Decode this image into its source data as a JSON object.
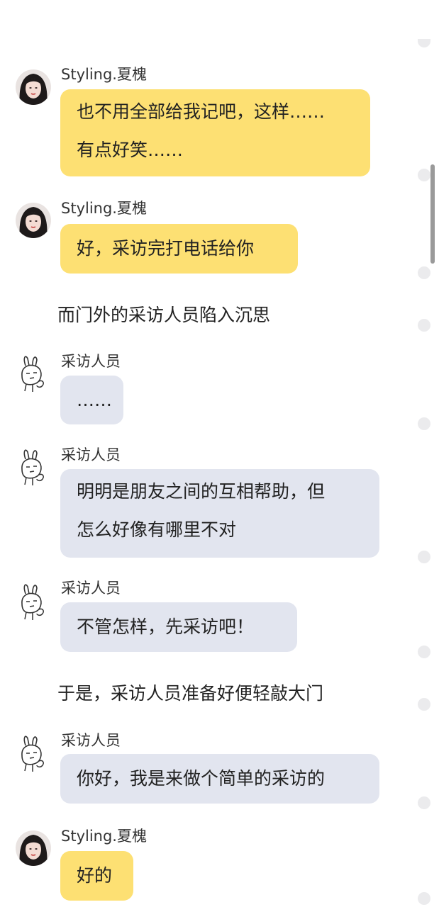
{
  "messages": [
    {
      "name": "Styling.夏槐",
      "lines": [
        "也不用全部给我记吧，这样……",
        "有点好笑……"
      ]
    },
    {
      "name": "Styling.夏槐",
      "lines": [
        "好，采访完打电话给你"
      ]
    },
    {
      "narration": "而门外的采访人员陷入沉思"
    },
    {
      "name": "采访人员",
      "lines": [
        "……"
      ]
    },
    {
      "name": "采访人员",
      "lines": [
        "明明是朋友之间的互相帮助，但",
        "怎么好像有哪里不对"
      ]
    },
    {
      "name": "采访人员",
      "lines": [
        "不管怎样，先采访吧！"
      ]
    },
    {
      "narration": "于是，采访人员准备好便轻敲大门"
    },
    {
      "name": "采访人员",
      "lines": [
        "你好，我是来做个简单的采访的"
      ]
    },
    {
      "name": "Styling.夏槐",
      "lines": [
        "好的"
      ]
    }
  ],
  "colors": {
    "self_bubble": "#fde073",
    "other_bubble": "#e2e5ef",
    "timeline_dot": "#ebebed"
  },
  "icons": {
    "host_avatar": "woman-portrait-avatar",
    "interviewer_avatar": "rabbit-sticker-icon"
  }
}
